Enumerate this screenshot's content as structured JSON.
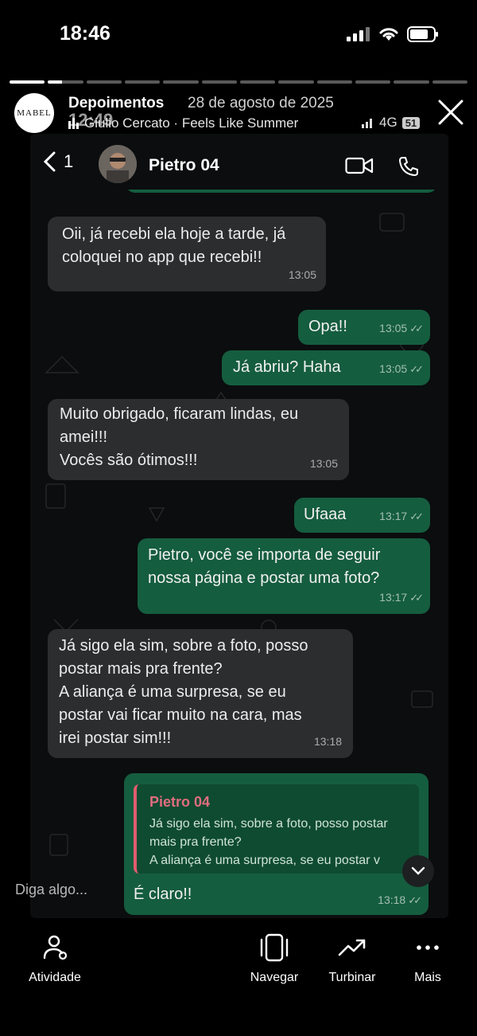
{
  "status_bar": {
    "time": "18:46"
  },
  "story": {
    "logo_text": "MABEL",
    "title": "Depoimentos",
    "date": "28 de agosto de 2025",
    "music": "Giulio Cercato · Feels Like Summer",
    "overlay_time": "12:49",
    "overlay_network": "4G",
    "overlay_battery": "51"
  },
  "chat": {
    "back_count": "1",
    "contact_name": "Pietro 04",
    "messages": [
      {
        "dir": "in",
        "text": "Oii, já recebi ela hoje a tarde, já\ncoloquei no app que recebi!!",
        "time": "13:05"
      },
      {
        "dir": "out",
        "text": "Opa!!",
        "time": "13:05"
      },
      {
        "dir": "out",
        "text": "Já abriu? Haha",
        "time": "13:05"
      },
      {
        "dir": "in",
        "text": "Muito obrigado, ficaram lindas, eu\namei!!!\nVocês são ótimos!!!",
        "time": "13:05"
      },
      {
        "dir": "out",
        "text": "Ufaaa",
        "time": "13:17"
      },
      {
        "dir": "out",
        "text": "Pietro, você se importa de seguir\nnossa página e postar uma foto?",
        "time": "13:17"
      },
      {
        "dir": "in",
        "text": "Já sigo ela sim, sobre a foto, posso\npostar mais pra frente?\nA aliança é uma surpresa, se eu\npostar vai ficar muito na cara, mas\nirei postar sim!!!",
        "time": "13:18"
      }
    ],
    "reply": {
      "quoted_name": "Pietro 04",
      "quoted_text": "Já sigo ela sim, sobre a foto, posso postar\nmais pra frente?\nA aliança é uma surpresa, se eu postar v",
      "text": "É claro!!",
      "time": "13:18"
    }
  },
  "reply_placeholder": "Diga algo...",
  "bottom_nav": [
    {
      "label": "Atividade",
      "icon": "activity-icon"
    },
    {
      "label": "Navegar",
      "icon": "navigate-icon"
    },
    {
      "label": "Turbinar",
      "icon": "boost-icon"
    },
    {
      "label": "Mais",
      "icon": "more-icon"
    }
  ],
  "colors": {
    "outgoing": "#155d3f",
    "incoming": "#2b2d2f",
    "quote_accent": "#e05c6e"
  }
}
